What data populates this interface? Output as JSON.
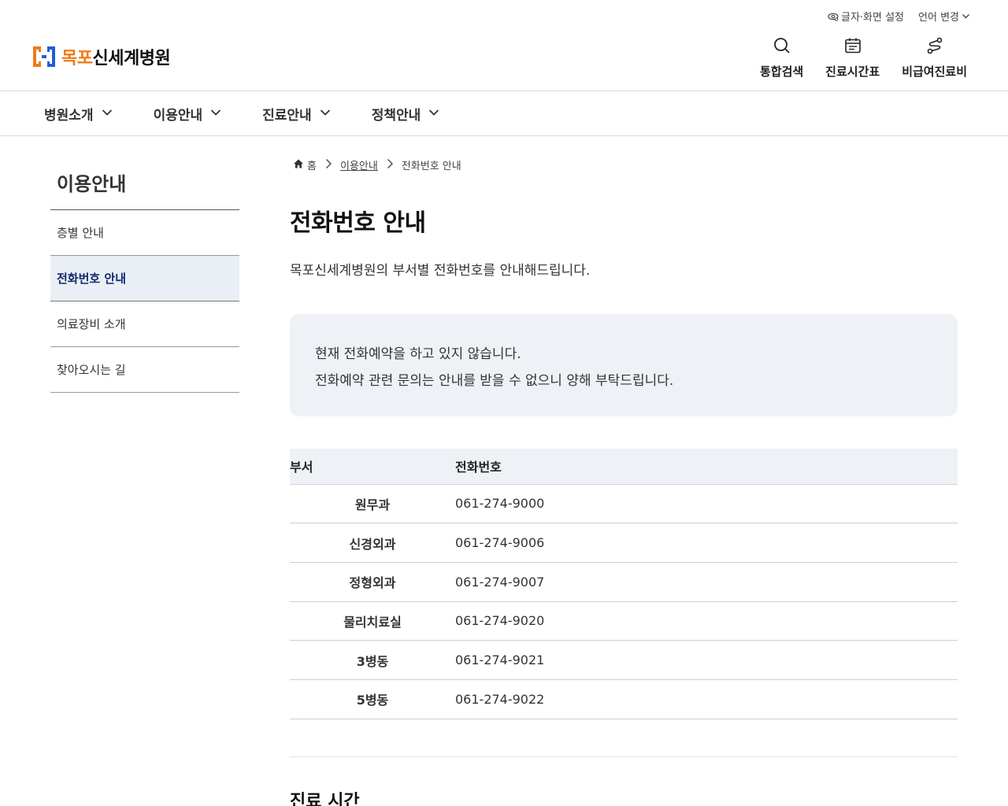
{
  "utility": {
    "display_setting": "글자·화면 설정",
    "language": "언어 변경"
  },
  "logo": {
    "orange_part": "목포",
    "dark_part": "신세계병원"
  },
  "quick": [
    {
      "label": "통합검색",
      "icon": "search-icon"
    },
    {
      "label": "진료시간표",
      "icon": "calendar-icon"
    },
    {
      "label": "비급여진료비",
      "icon": "route-icon"
    }
  ],
  "gnb": [
    {
      "label": "병원소개"
    },
    {
      "label": "이용안내"
    },
    {
      "label": "진료안내"
    },
    {
      "label": "정책안내"
    }
  ],
  "sidebar": {
    "title": "이용안내",
    "items": [
      {
        "label": "층별 안내"
      },
      {
        "label": "전화번호 안내"
      },
      {
        "label": "의료장비 소개"
      },
      {
        "label": "찾아오시는 길"
      }
    ]
  },
  "breadcrumb": {
    "home": "홈",
    "level1": "이용안내",
    "current": "전화번호 안내"
  },
  "page": {
    "title": "전화번호 안내",
    "description": "목포신세계병원의 부서별 전화번호를 안내해드립니다.",
    "notice_line1": "현재 전화예약을 하고 있지 않습니다.",
    "notice_line2": "전화예약 관련 문의는 안내를 받을 수 없으니 양해 부탁드립니다."
  },
  "table": {
    "headers": [
      "부서",
      "전화번호"
    ],
    "rows": [
      [
        "원무과",
        "061-274-9000"
      ],
      [
        "신경외과",
        "061-274-9006"
      ],
      [
        "정형외과",
        "061-274-9007"
      ],
      [
        "물리치료실",
        "061-274-9020"
      ],
      [
        "3병동",
        "061-274-9021"
      ],
      [
        "5병동",
        "061-274-9022"
      ]
    ]
  },
  "next_section": {
    "title": "진료 시간"
  },
  "colors": {
    "brand_orange": "#f07a1a",
    "brand_blue": "#1f5fd1",
    "active_bg": "#eaeff5",
    "panel_bg": "#eef1f6"
  }
}
